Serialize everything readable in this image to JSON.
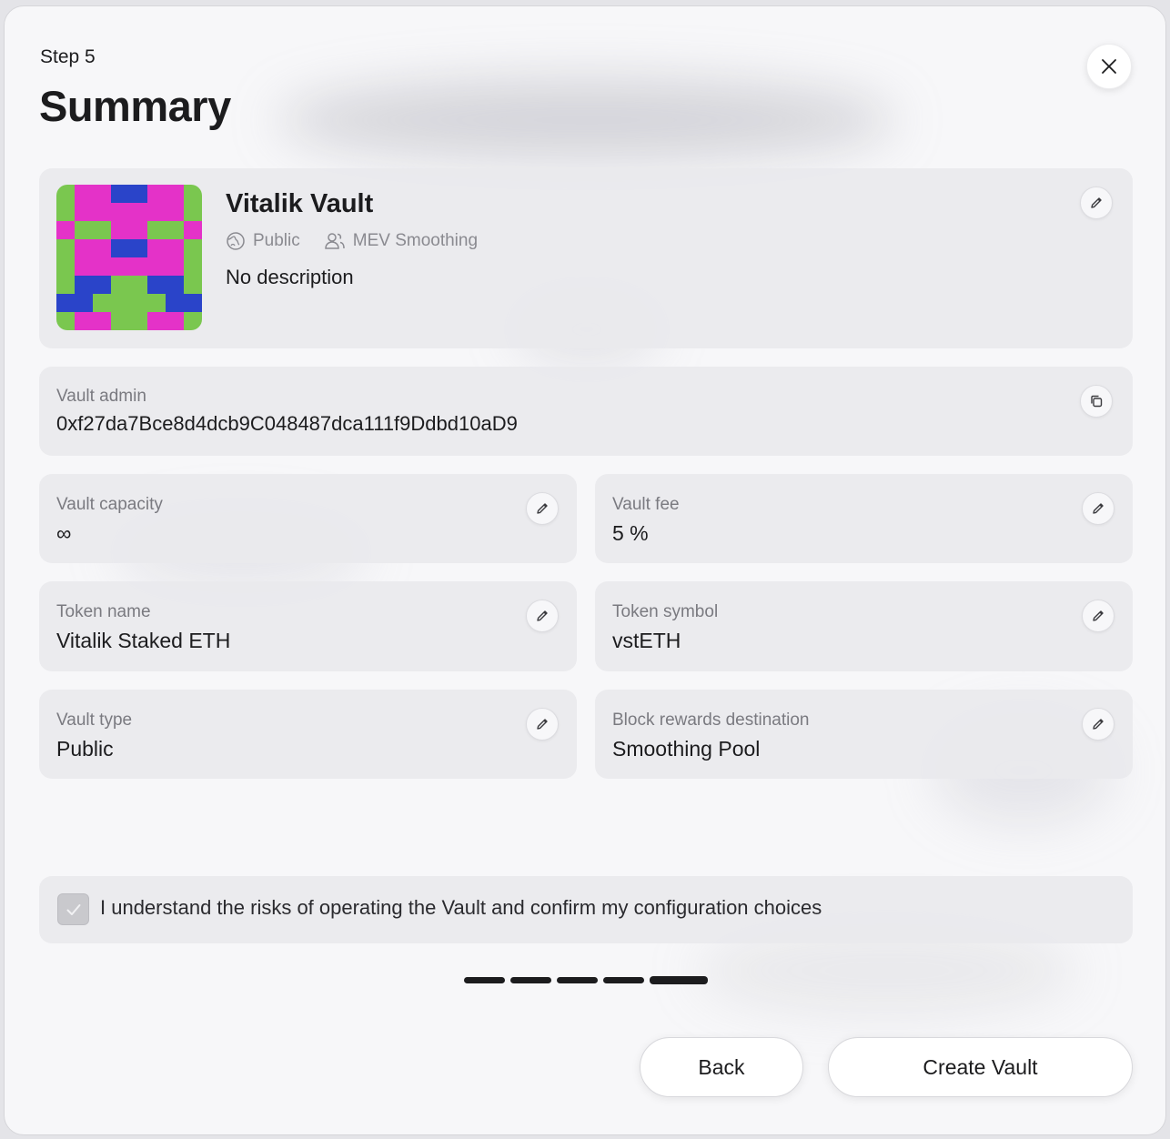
{
  "header": {
    "step_label": "Step 5",
    "title": "Summary"
  },
  "vault": {
    "name": "Vitalik Vault",
    "visibility_label": "Public",
    "mev_label": "MEV Smoothing",
    "description": "No description",
    "avatar_colors": [
      "#e432c8",
      "#7ac74f",
      "#2a44c9"
    ]
  },
  "fields": {
    "admin": {
      "label": "Vault admin",
      "value": "0xf27da7Bce8d4dcb9C048487dca111f9Ddbd10aD9"
    },
    "capacity": {
      "label": "Vault capacity",
      "value": "∞"
    },
    "fee": {
      "label": "Vault fee",
      "value": "5 %"
    },
    "token_name": {
      "label": "Token name",
      "value": "Vitalik Staked ETH"
    },
    "token_symbol": {
      "label": "Token symbol",
      "value": "vstETH"
    },
    "vault_type": {
      "label": "Vault type",
      "value": "Public"
    },
    "rewards_destination": {
      "label": "Block rewards destination",
      "value": "Smoothing Pool"
    }
  },
  "confirm": {
    "text": "I understand the risks of operating the Vault and confirm my configuration choices",
    "checked": true
  },
  "progress": {
    "current_step": 5,
    "total_steps": 5
  },
  "actions": {
    "back_label": "Back",
    "create_label": "Create Vault"
  },
  "colors": {
    "text": "#1c1c1e",
    "muted": "#7a7a80",
    "card": "#e9e9ed",
    "background": "#f7f7f9"
  },
  "icons": [
    "close-icon",
    "edit-icon",
    "copy-icon",
    "globe-icon",
    "users-icon",
    "check-icon"
  ]
}
